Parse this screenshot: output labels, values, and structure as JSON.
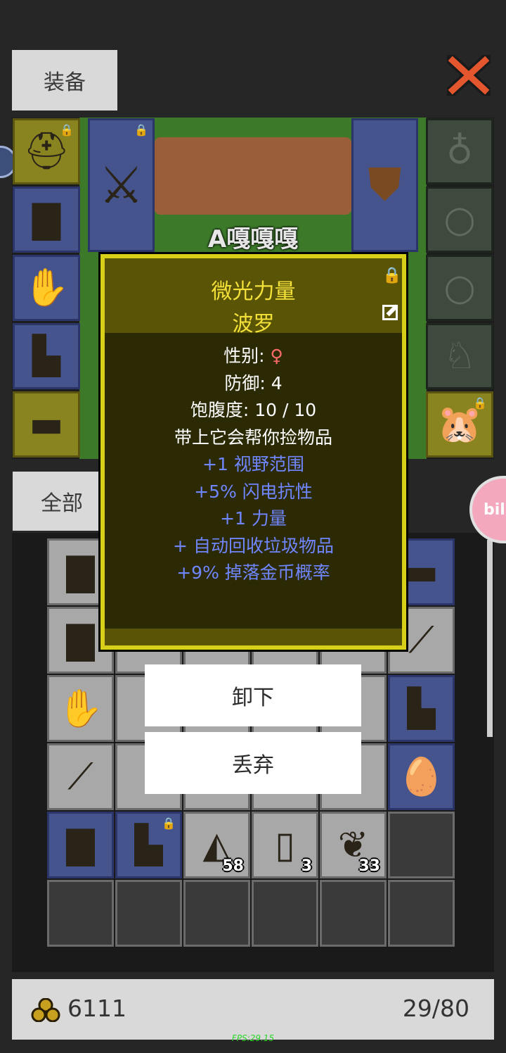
{
  "header": {
    "equip_tab": "装备",
    "close_icon": "close-x-icon"
  },
  "character": {
    "name": "A嘎嘎嘎"
  },
  "left_slots": [
    {
      "icon": "helmet-icon",
      "glyph": "⛑",
      "style": "yellow",
      "locked": true
    },
    {
      "icon": "armor-icon",
      "glyph": "▇",
      "style": "blue",
      "locked": false
    },
    {
      "icon": "glove-icon",
      "glyph": "✋",
      "style": "blue",
      "locked": false
    },
    {
      "icon": "boots-icon",
      "glyph": "▙",
      "style": "blue",
      "locked": false
    },
    {
      "icon": "belt-icon",
      "glyph": "▬",
      "style": "yellow",
      "locked": false
    }
  ],
  "right_slots": [
    {
      "icon": "amulet-icon",
      "glyph": "♁",
      "style": "dark"
    },
    {
      "icon": "ring-icon",
      "glyph": "○",
      "style": "dark"
    },
    {
      "icon": "ring-icon",
      "glyph": "○",
      "style": "dark"
    },
    {
      "icon": "pet-icon",
      "glyph": "♘",
      "style": "dark"
    },
    {
      "icon": "hamster-pet-icon",
      "glyph": "🐹",
      "style": "yellow",
      "locked": true
    }
  ],
  "weapon_slot": {
    "icon": "crossed-swords-icon",
    "glyph": "⚔",
    "locked": true
  },
  "shield_slot": {
    "icon": "shield-icon",
    "glyph": "⛊"
  },
  "filter_tab": "全部",
  "tooltip": {
    "title": "微光力量",
    "name": "波罗",
    "lock_icon": "lock-icon",
    "edit_icon": "edit-icon",
    "gender_label": "性别: ",
    "gender_symbol": "♀",
    "lines": [
      "防御: 4",
      "饱腹度: 10 / 10",
      "带上它会帮你捡物品"
    ],
    "bonuses": [
      "+1 视野范围",
      "+5% 闪电抗性",
      "+1 力量",
      "+ 自动回收垃圾物品",
      "+9% 掉落金币概率"
    ]
  },
  "actions": {
    "unequip": "卸下",
    "discard": "丢弃"
  },
  "inventory": {
    "rows": [
      [
        {
          "icon": "armor-icon",
          "glyph": "▇",
          "style": "grey"
        },
        {},
        {},
        {},
        {},
        {
          "icon": "belt-icon",
          "glyph": "▬",
          "style": "blue"
        }
      ],
      [
        {
          "icon": "armor-icon",
          "glyph": "▇",
          "style": "grey"
        },
        {},
        {},
        {},
        {},
        {
          "icon": "bow-icon",
          "glyph": "⟋",
          "style": "grey"
        }
      ],
      [
        {
          "icon": "glove-icon",
          "glyph": "✋",
          "style": "grey"
        },
        {},
        {},
        {},
        {},
        {
          "icon": "boots-icon",
          "glyph": "▙",
          "style": "blue"
        }
      ],
      [
        {
          "icon": "spear-icon",
          "glyph": "⟋",
          "style": "grey"
        },
        {},
        {},
        {},
        {},
        {
          "icon": "egg-icon",
          "glyph": "🥚",
          "style": "blue"
        }
      ],
      [
        {
          "icon": "armor-icon",
          "glyph": "▇",
          "style": "blue"
        },
        {
          "icon": "boots-icon",
          "glyph": "▙",
          "style": "blue",
          "locked": true
        },
        {
          "icon": "cheese-icon",
          "glyph": "◭",
          "style": "grey",
          "count": "58"
        },
        {
          "icon": "scroll-icon",
          "glyph": "▯",
          "style": "grey",
          "count": "3"
        },
        {
          "icon": "red-leaf-icon",
          "glyph": "❦",
          "style": "grey",
          "count": "33"
        },
        {
          "style": "empty"
        }
      ],
      [
        {
          "style": "empty"
        },
        {
          "style": "empty"
        },
        {
          "style": "empty"
        },
        {
          "style": "empty"
        },
        {
          "style": "empty"
        },
        {
          "style": "empty"
        }
      ]
    ]
  },
  "footer": {
    "gold_icon": "gold-coins-icon",
    "gold": "6111",
    "capacity": "29/80"
  },
  "fps": "FPS:29.15",
  "colors": {
    "tooltip_bg": "#2c2a05",
    "tooltip_border": "#d8cf18",
    "title": "#f3e13a",
    "bonus": "#6f86ff",
    "gender": "#ff6b6b"
  }
}
